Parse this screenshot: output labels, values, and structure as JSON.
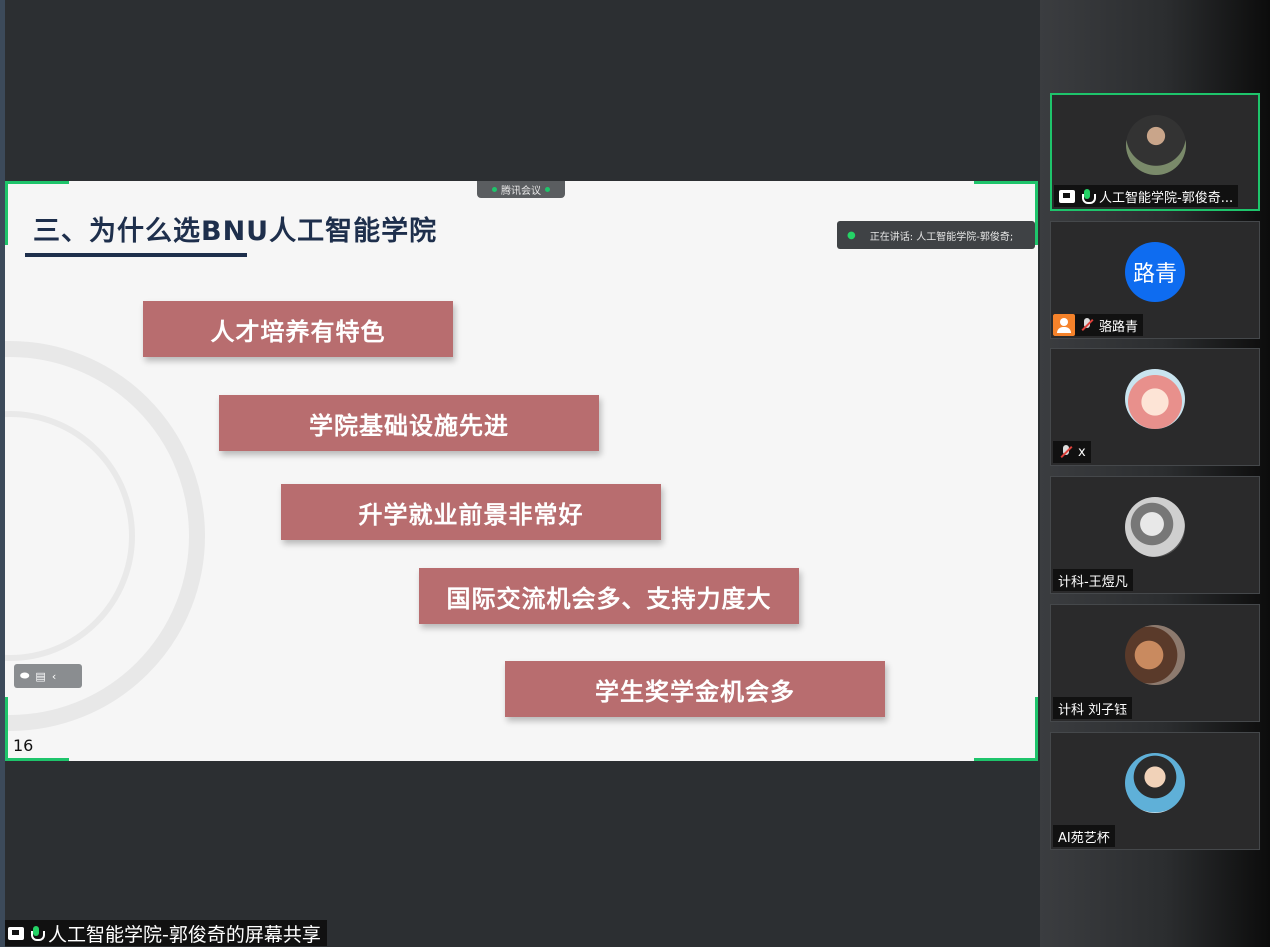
{
  "slide": {
    "title": "三、为什么选BNU人工智能学院",
    "bars": [
      "人才培养有特色",
      "学院基础设施先进",
      "升学就业前景非常好",
      "国际交流机会多、支持力度大",
      "学生奖学金机会多"
    ],
    "page_number": "16",
    "meeting_pill": "腾讯会议",
    "speaking_indicator": "正在讲话: 人工智能学院-郭俊奇;"
  },
  "participants": [
    {
      "name": "人工智能学院-郭俊奇...",
      "avatar": "photo",
      "active": true
    },
    {
      "name": "骆路青",
      "avatar_text": "路青"
    },
    {
      "name": "x"
    },
    {
      "name": "计科-王煜凡"
    },
    {
      "name": "计科 刘子钰"
    },
    {
      "name": "AI苑艺杯"
    }
  ],
  "bottom_label": "人工智能学院-郭俊奇的屏幕共享",
  "colors": {
    "accent_green": "#1ec46b",
    "bar_red": "#b86d6f",
    "title_navy": "#1e2f4c",
    "avatar_blue": "#0e6cf0"
  }
}
